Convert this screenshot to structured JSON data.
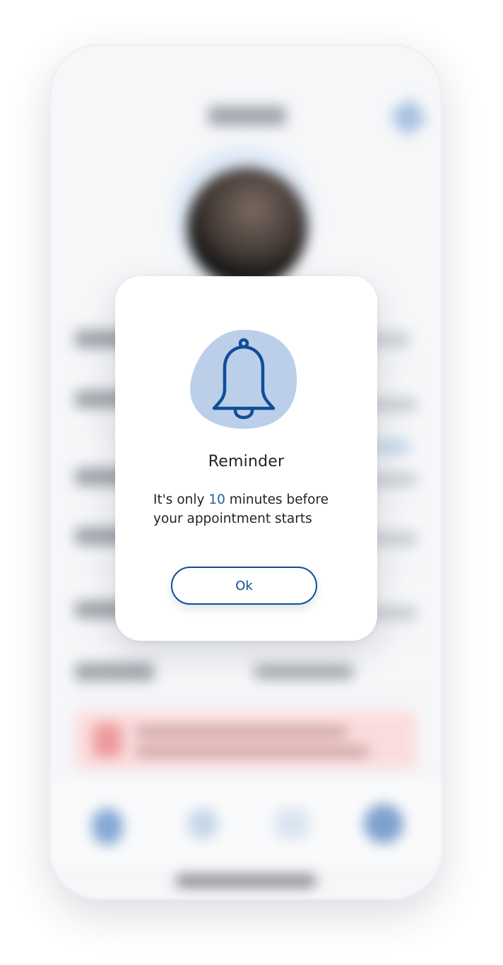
{
  "dialog": {
    "icon": "bell-icon",
    "title": "Reminder",
    "message_before": "It's only ",
    "minutes": "10",
    "message_after": " minutes before your appointment starts",
    "ok_label": "Ok"
  },
  "colors": {
    "accent": "#0f4d98",
    "highlight": "#1f5fa6",
    "illustration_blob": "#bccfe9",
    "text": "#1f2328",
    "alert_background": "#fbdcdd"
  },
  "background_screen": {
    "state": "blurred",
    "tab_icons": [
      "profile-tab-icon",
      "calls-tab-icon",
      "chat-tab-icon",
      "settings-tab-icon"
    ]
  }
}
